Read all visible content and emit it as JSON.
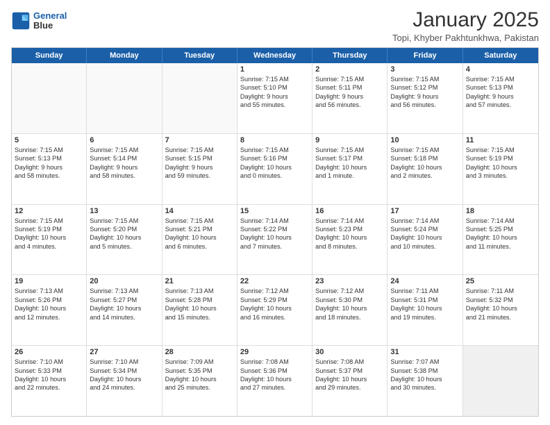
{
  "header": {
    "logo_line1": "General",
    "logo_line2": "Blue",
    "month_title": "January 2025",
    "location": "Topi, Khyber Pakhtunkhwa, Pakistan"
  },
  "weekdays": [
    "Sunday",
    "Monday",
    "Tuesday",
    "Wednesday",
    "Thursday",
    "Friday",
    "Saturday"
  ],
  "rows": [
    [
      {
        "day": "",
        "info": "",
        "empty": true
      },
      {
        "day": "",
        "info": "",
        "empty": true
      },
      {
        "day": "",
        "info": "",
        "empty": true
      },
      {
        "day": "1",
        "info": "Sunrise: 7:15 AM\nSunset: 5:10 PM\nDaylight: 9 hours\nand 55 minutes.",
        "empty": false
      },
      {
        "day": "2",
        "info": "Sunrise: 7:15 AM\nSunset: 5:11 PM\nDaylight: 9 hours\nand 56 minutes.",
        "empty": false
      },
      {
        "day": "3",
        "info": "Sunrise: 7:15 AM\nSunset: 5:12 PM\nDaylight: 9 hours\nand 56 minutes.",
        "empty": false
      },
      {
        "day": "4",
        "info": "Sunrise: 7:15 AM\nSunset: 5:13 PM\nDaylight: 9 hours\nand 57 minutes.",
        "empty": false
      }
    ],
    [
      {
        "day": "5",
        "info": "Sunrise: 7:15 AM\nSunset: 5:13 PM\nDaylight: 9 hours\nand 58 minutes.",
        "empty": false
      },
      {
        "day": "6",
        "info": "Sunrise: 7:15 AM\nSunset: 5:14 PM\nDaylight: 9 hours\nand 58 minutes.",
        "empty": false
      },
      {
        "day": "7",
        "info": "Sunrise: 7:15 AM\nSunset: 5:15 PM\nDaylight: 9 hours\nand 59 minutes.",
        "empty": false
      },
      {
        "day": "8",
        "info": "Sunrise: 7:15 AM\nSunset: 5:16 PM\nDaylight: 10 hours\nand 0 minutes.",
        "empty": false
      },
      {
        "day": "9",
        "info": "Sunrise: 7:15 AM\nSunset: 5:17 PM\nDaylight: 10 hours\nand 1 minute.",
        "empty": false
      },
      {
        "day": "10",
        "info": "Sunrise: 7:15 AM\nSunset: 5:18 PM\nDaylight: 10 hours\nand 2 minutes.",
        "empty": false
      },
      {
        "day": "11",
        "info": "Sunrise: 7:15 AM\nSunset: 5:19 PM\nDaylight: 10 hours\nand 3 minutes.",
        "empty": false
      }
    ],
    [
      {
        "day": "12",
        "info": "Sunrise: 7:15 AM\nSunset: 5:19 PM\nDaylight: 10 hours\nand 4 minutes.",
        "empty": false
      },
      {
        "day": "13",
        "info": "Sunrise: 7:15 AM\nSunset: 5:20 PM\nDaylight: 10 hours\nand 5 minutes.",
        "empty": false
      },
      {
        "day": "14",
        "info": "Sunrise: 7:15 AM\nSunset: 5:21 PM\nDaylight: 10 hours\nand 6 minutes.",
        "empty": false
      },
      {
        "day": "15",
        "info": "Sunrise: 7:14 AM\nSunset: 5:22 PM\nDaylight: 10 hours\nand 7 minutes.",
        "empty": false
      },
      {
        "day": "16",
        "info": "Sunrise: 7:14 AM\nSunset: 5:23 PM\nDaylight: 10 hours\nand 8 minutes.",
        "empty": false
      },
      {
        "day": "17",
        "info": "Sunrise: 7:14 AM\nSunset: 5:24 PM\nDaylight: 10 hours\nand 10 minutes.",
        "empty": false
      },
      {
        "day": "18",
        "info": "Sunrise: 7:14 AM\nSunset: 5:25 PM\nDaylight: 10 hours\nand 11 minutes.",
        "empty": false
      }
    ],
    [
      {
        "day": "19",
        "info": "Sunrise: 7:13 AM\nSunset: 5:26 PM\nDaylight: 10 hours\nand 12 minutes.",
        "empty": false
      },
      {
        "day": "20",
        "info": "Sunrise: 7:13 AM\nSunset: 5:27 PM\nDaylight: 10 hours\nand 14 minutes.",
        "empty": false
      },
      {
        "day": "21",
        "info": "Sunrise: 7:13 AM\nSunset: 5:28 PM\nDaylight: 10 hours\nand 15 minutes.",
        "empty": false
      },
      {
        "day": "22",
        "info": "Sunrise: 7:12 AM\nSunset: 5:29 PM\nDaylight: 10 hours\nand 16 minutes.",
        "empty": false
      },
      {
        "day": "23",
        "info": "Sunrise: 7:12 AM\nSunset: 5:30 PM\nDaylight: 10 hours\nand 18 minutes.",
        "empty": false
      },
      {
        "day": "24",
        "info": "Sunrise: 7:11 AM\nSunset: 5:31 PM\nDaylight: 10 hours\nand 19 minutes.",
        "empty": false
      },
      {
        "day": "25",
        "info": "Sunrise: 7:11 AM\nSunset: 5:32 PM\nDaylight: 10 hours\nand 21 minutes.",
        "empty": false
      }
    ],
    [
      {
        "day": "26",
        "info": "Sunrise: 7:10 AM\nSunset: 5:33 PM\nDaylight: 10 hours\nand 22 minutes.",
        "empty": false
      },
      {
        "day": "27",
        "info": "Sunrise: 7:10 AM\nSunset: 5:34 PM\nDaylight: 10 hours\nand 24 minutes.",
        "empty": false
      },
      {
        "day": "28",
        "info": "Sunrise: 7:09 AM\nSunset: 5:35 PM\nDaylight: 10 hours\nand 25 minutes.",
        "empty": false
      },
      {
        "day": "29",
        "info": "Sunrise: 7:08 AM\nSunset: 5:36 PM\nDaylight: 10 hours\nand 27 minutes.",
        "empty": false
      },
      {
        "day": "30",
        "info": "Sunrise: 7:08 AM\nSunset: 5:37 PM\nDaylight: 10 hours\nand 29 minutes.",
        "empty": false
      },
      {
        "day": "31",
        "info": "Sunrise: 7:07 AM\nSunset: 5:38 PM\nDaylight: 10 hours\nand 30 minutes.",
        "empty": false
      },
      {
        "day": "",
        "info": "",
        "empty": true,
        "shaded": true
      }
    ]
  ]
}
